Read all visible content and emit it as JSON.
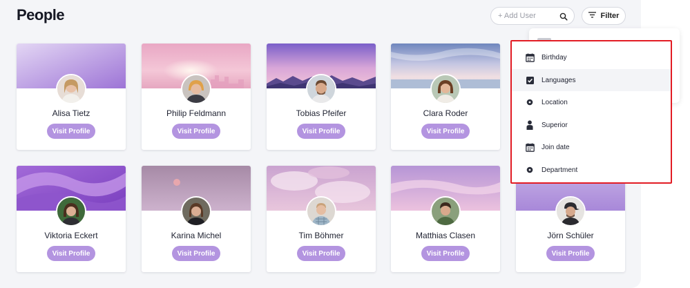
{
  "page": {
    "title": "People"
  },
  "search": {
    "placeholder": "+ Add User"
  },
  "filter": {
    "label": "Filter"
  },
  "people": [
    {
      "name": "Alisa Tietz",
      "action": "Visit Profile"
    },
    {
      "name": "Philip Feldmann",
      "action": "Visit Profile"
    },
    {
      "name": "Tobias Pfeifer",
      "action": "Visit Profile"
    },
    {
      "name": "Clara Roder",
      "action": "Visit Profile"
    },
    {
      "name": "Viktoria Eckert",
      "action": "Visit Profile"
    },
    {
      "name": "Karina Michel",
      "action": "Visit Profile"
    },
    {
      "name": "Tim Böhmer",
      "action": "Visit Profile"
    },
    {
      "name": "Matthias Clasen",
      "action": "Visit Profile"
    },
    {
      "name": "Jörn Schüler",
      "action": "Visit Profile"
    }
  ],
  "filter_menu": {
    "items": [
      {
        "label": "Birthday",
        "icon": "calendar-icon"
      },
      {
        "label": "Languages",
        "icon": "checkbox-icon",
        "active": true
      },
      {
        "label": "Location",
        "icon": "location-dot-icon"
      },
      {
        "label": "Superior",
        "icon": "person-icon"
      },
      {
        "label": "Join date",
        "icon": "calendar-icon"
      },
      {
        "label": "Department",
        "icon": "department-dot-icon"
      }
    ]
  },
  "colors": {
    "accent": "#b394e0",
    "highlight_border": "#e21b23",
    "panel_background": "#f4f5f8"
  }
}
